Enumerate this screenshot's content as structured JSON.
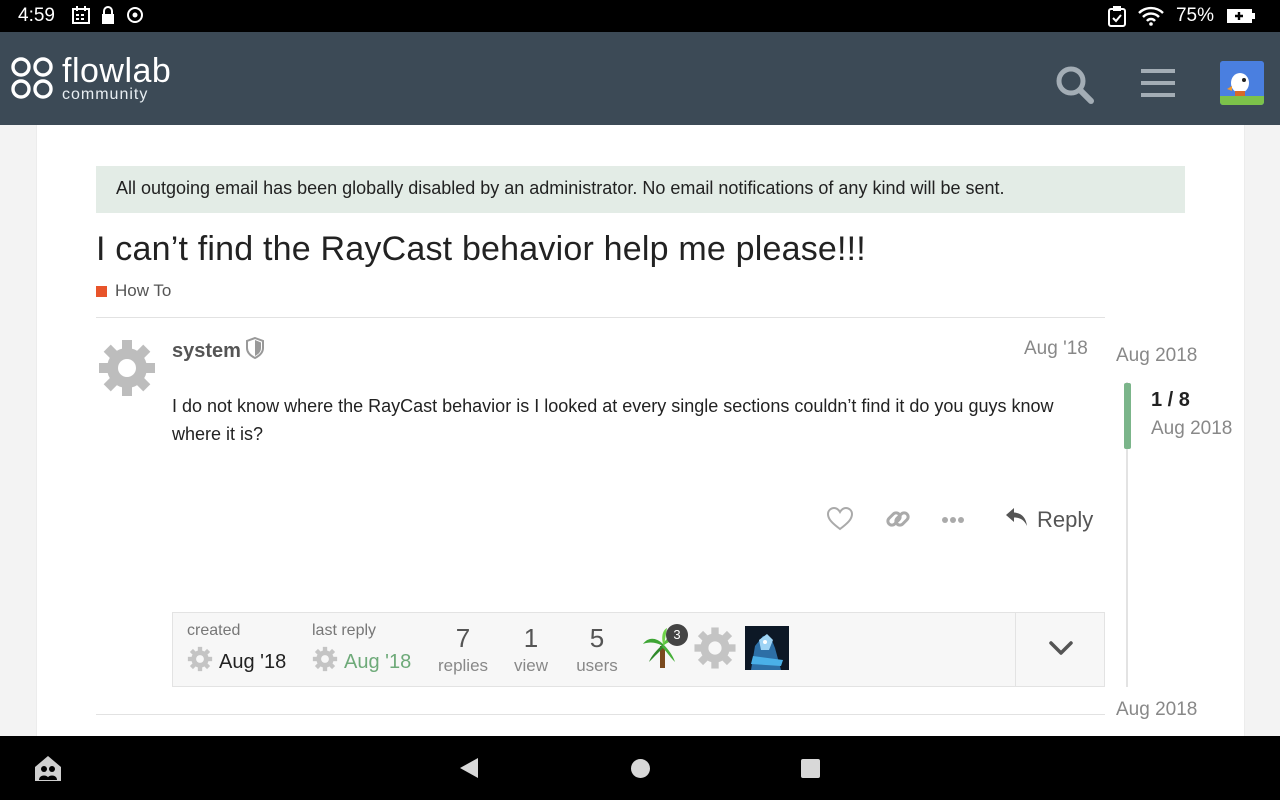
{
  "status_bar": {
    "time": "4:59",
    "battery": "75%"
  },
  "header": {
    "logo_word": "flowlab",
    "logo_sub": "community"
  },
  "notice": "All outgoing email has been globally disabled by an administrator. No email notifications of any kind will be sent.",
  "topic": {
    "title": "I can’t find the RayCast behavior help me please!!!",
    "category": "How To",
    "category_color": "#e8542a"
  },
  "post": {
    "username": "system",
    "date": "Aug '18",
    "body": "I do not know where the RayCast behavior is I looked at every single sections couldn’t find it do you guys know where it is?",
    "reply_label": "Reply"
  },
  "topic_map": {
    "created_label": "created",
    "created_value": "Aug '18",
    "last_reply_label": "last reply",
    "last_reply_value": "Aug '18",
    "replies_count": "7",
    "replies_label": "replies",
    "views_count": "1",
    "views_label": "view",
    "users_count": "5",
    "users_label": "users",
    "user_badge": "3"
  },
  "timeline": {
    "top_date": "Aug 2018",
    "position": "1 / 8",
    "position_date": "Aug 2018",
    "bottom_date": "Aug 2018"
  },
  "colors": {
    "header_bg": "#3c4a56",
    "accent_green": "#7bb58a"
  }
}
